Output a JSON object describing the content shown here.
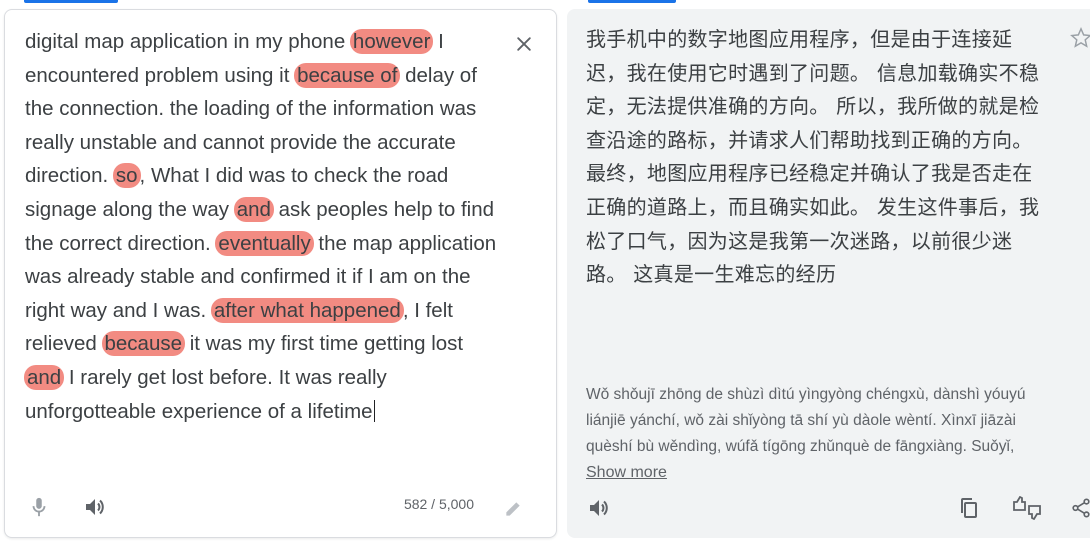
{
  "source": {
    "segments": [
      {
        "text": "digital map application in my phone ",
        "hl": false
      },
      {
        "text": "however",
        "hl": true
      },
      {
        "text": " I encountered problem using it ",
        "hl": false
      },
      {
        "text": "because of",
        "hl": true
      },
      {
        "text": " delay of the connection. the loading of the information was really unstable and cannot provide the accurate direction. ",
        "hl": false
      },
      {
        "text": "so",
        "hl": true
      },
      {
        "text": ", What I did was to check the road signage along the way ",
        "hl": false
      },
      {
        "text": "and",
        "hl": true
      },
      {
        "text": " ask peoples help to find the correct direction. ",
        "hl": false
      },
      {
        "text": "eventually",
        "hl": true
      },
      {
        "text": " the map application was already stable and confirmed it if I am on the right way and I was. ",
        "hl": false
      },
      {
        "text": "after what happened",
        "hl": true
      },
      {
        "text": ", I felt relieved ",
        "hl": false
      },
      {
        "text": "because",
        "hl": true
      },
      {
        "text": " it was my first time getting lost ",
        "hl": false
      },
      {
        "text": "and",
        "hl": true
      },
      {
        "text": " I rarely get lost before. It was really unforgotteable experience of a lifetime",
        "hl": false
      }
    ],
    "char_count": "582 / 5,000",
    "highlight_color": "#f28b82",
    "icons": {
      "clear": "close-icon",
      "mic": "microphone-icon",
      "listen": "speaker-icon",
      "edit": "pencil-icon"
    }
  },
  "target": {
    "translation": "我手机中的数字地图应用程序，但是由于连接延迟，我在使用它时遇到了问题。 信息加载确实不稳定，无法提供准确的方向。 所以，我所做的就是检查沿途的路标，并请求人们帮助找到正确的方向。 最终，地图应用程序已经稳定并确认了我是否走在正确的道路上，而且确实如此。 发生这件事后，我松了口气，因为这是我第一次迷路，以前很少迷路。 这真是一生难忘的经历",
    "transliteration": "Wǒ shǒujī zhōng de shùzì dìtú yìngyòng chéngxù, dànshì yóuyú liánjiē yánchí, wǒ zài shǐyòng tā shí yù dàole wèntí. Xìnxī jiāzài quèshí bù wěndìng, wúfǎ tígōng zhǔnquè de fāngxiàng. Suǒyǐ,",
    "show_more_label": "Show more",
    "icons": {
      "star": "star-icon",
      "listen": "speaker-icon",
      "copy": "copy-icon",
      "feedback": "rate-translation-icon",
      "share": "share-icon"
    }
  },
  "colors": {
    "accent": "#1a73e8",
    "target_bg": "#f1f3f4",
    "border": "#dadce0"
  }
}
